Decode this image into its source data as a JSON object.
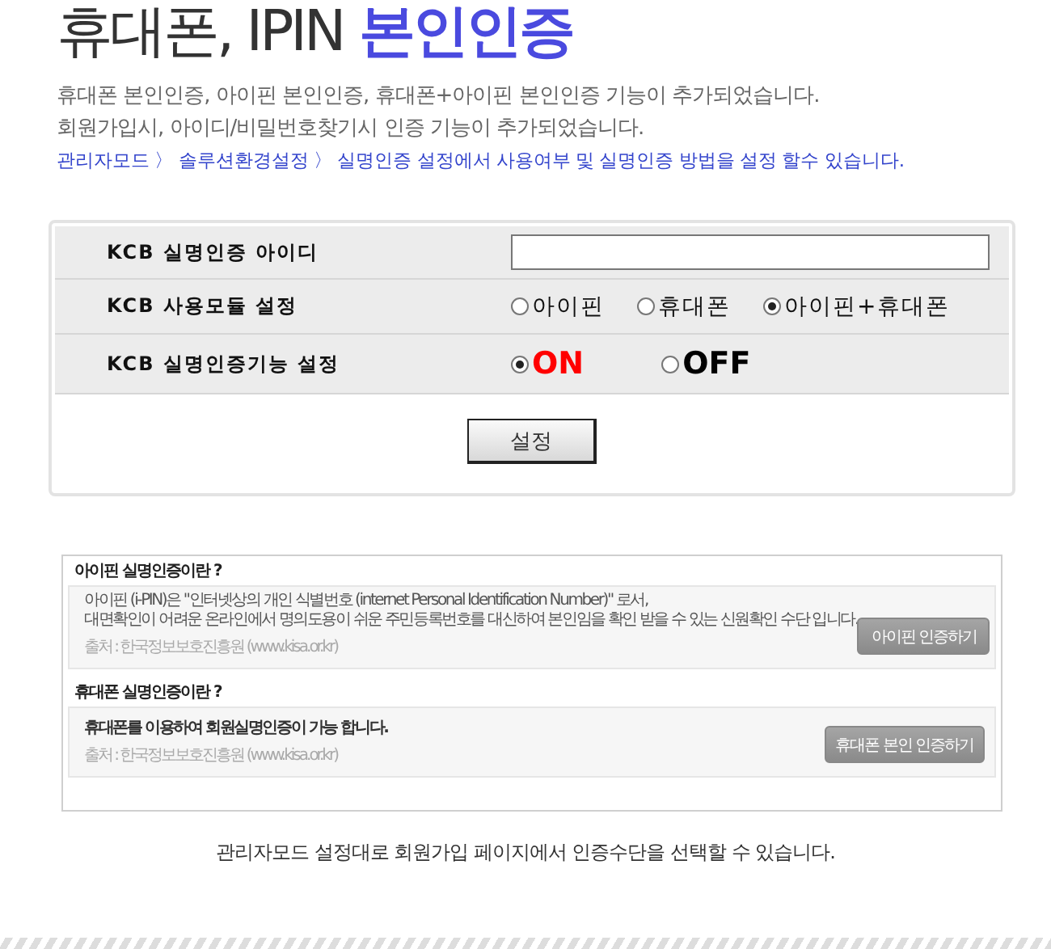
{
  "header": {
    "title": "휴대폰, IPIN",
    "title_highlight": "본인인증",
    "descriptions": [
      "휴대폰 본인인증, 아이핀 본인인증, 휴대폰+아이핀 본인인증 기능이 추가되었습니다.",
      "회원가입시, 아이디/비밀번호찾기시 인증 기능이 추가되었습니다."
    ],
    "path_note": "관리자모드 〉 솔루션환경설정 〉 실명인증 설정에서 사용여부 및 실명인증 방법을 설정 할수 있습니다."
  },
  "settings": {
    "rows": [
      {
        "kind": "text",
        "label": "KCB 실명인증 아이디"
      },
      {
        "kind": "radio",
        "label": "KCB 사용모듈 설정",
        "options": [
          {
            "label": "아이핀",
            "selected": false
          },
          {
            "label": "휴대폰",
            "selected": false
          },
          {
            "label": "아이핀+휴대폰",
            "selected": true
          }
        ]
      },
      {
        "kind": "toggle",
        "label": "KCB 실명인증기능 설정",
        "options": [
          {
            "label": "ON",
            "selected": true,
            "color": "#ff0000"
          },
          {
            "label": "OFF",
            "selected": false,
            "color": "#000000"
          }
        ]
      }
    ],
    "button": "설정"
  },
  "preview": {
    "sections": [
      {
        "kind": "detail",
        "title": "아이핀 실명인증이란 ?",
        "body": [
          "아이핀 (i-PIN)은 \"인터넷상의 개인 식별번호 (internet Personal Identification Number)\" 로서,",
          "대면확인이 어려운 온라인에서 명의도용이 쉬운 주민등록번호를 대신하여 본인임을 확인 받을 수 있는 신원확인 수단 입니다."
        ],
        "source": "출처 : 한국정보보호진흥원 (www.kisa.or.kr)",
        "button": "아이핀 인증하기"
      },
      {
        "kind": "summary",
        "title": "휴대폰 실명인증이란 ?",
        "body": [
          "휴대폰를 이용하여 회원실명인증이 가능 합니다."
        ],
        "source": "출처 : 한국정보보호진흥원 (www.kisa.or.kr)",
        "button": "휴대폰 본인 인증하기"
      }
    ]
  },
  "caption": "관리자모드 설정대로 회원가입 페이지에서 인증수단을 선택할 수 있습니다."
}
